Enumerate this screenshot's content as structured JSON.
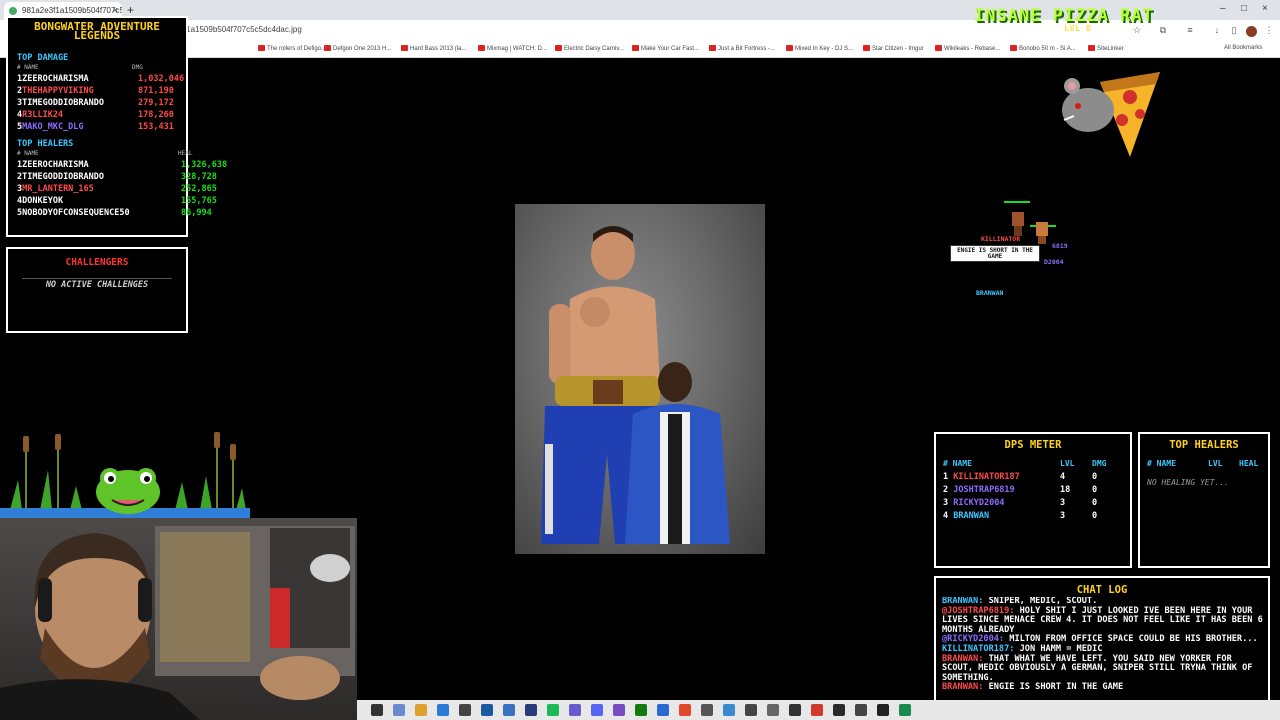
{
  "browser": {
    "tab_title": "981a2e3f1a1509b504f707c5c5dc4dac.jpg",
    "url": "e3f1a1509b504f707c5c5dc4dac.jpg",
    "bookmarks": [
      "The rollers of Defigo...",
      "Defgon One 2013 H...",
      "Hard Bass 2013 (la...",
      "Mixmag | WATCH: D...",
      "Electric Daisy Carniv...",
      "Make Your Car Fast...",
      "Just a Bit Fortress -...",
      "Mixed In Key - DJ S...",
      "Star Citizen - Imgur",
      "Wikileaks - Rebase...",
      "Bonobo 50 m - Si A...",
      "SiteLinker"
    ],
    "all_bookmarks": "All Bookmarks"
  },
  "leaderboard": {
    "title": "BONGWATER ADVENTURE LEGENDS",
    "damage": {
      "heading": "TOP DAMAGE",
      "col_name": "# NAME",
      "col_value": "DMG",
      "rows": [
        {
          "rank": "1",
          "name": "ZEEROCHARISMA",
          "value": "1,032,046"
        },
        {
          "rank": "2",
          "name": "THEHAPPYVIKING",
          "value": "871,190"
        },
        {
          "rank": "3",
          "name": "TIMEGODDIOBRANDO",
          "value": "279,172"
        },
        {
          "rank": "4",
          "name": "R3LLIK24",
          "value": "178,260"
        },
        {
          "rank": "5",
          "name": "MAKO_MKC_DLG",
          "value": "153,431"
        }
      ]
    },
    "heal": {
      "heading": "TOP HEALERS",
      "col_name": "# NAME",
      "col_value": "HEAL",
      "rows": [
        {
          "rank": "1",
          "name": "ZEEROCHARISMA",
          "value": "1,326,638"
        },
        {
          "rank": "2",
          "name": "TIMEGODDIOBRANDO",
          "value": "328,728"
        },
        {
          "rank": "3",
          "name": "MR_LANTERN_165",
          "value": "252,865"
        },
        {
          "rank": "4",
          "name": "DONKEYOK",
          "value": "155,765"
        },
        {
          "rank": "5",
          "name": "NOBODYOFCONSEQUENCE50",
          "value": "86,994"
        }
      ]
    }
  },
  "challengers": {
    "title": "CHALLENGERS",
    "empty": "NO ACTIVE CHALLENGES"
  },
  "scene": {
    "title": "INSANE PIZZA RAT",
    "level": "LVL 8",
    "bubble": "ENGIE IS SHORT IN THE GAME",
    "players": [
      {
        "name": "KILLINATOR",
        "color": "#ff4a4a"
      },
      {
        "name": "6819",
        "color": "#8f6bff"
      },
      {
        "name": "D2004",
        "color": "#8f6bff"
      },
      {
        "name": "BRANWAN",
        "color": "#3bc8ff"
      }
    ]
  },
  "dps": {
    "title": "DPS METER",
    "headers": {
      "name": "# NAME",
      "lvl": "LVL",
      "dmg": "DMG"
    },
    "rows": [
      {
        "rank": "1",
        "name": "KILLINATOR187",
        "lvl": "4",
        "dmg": "0",
        "color": "#ff4a4a"
      },
      {
        "rank": "2",
        "name": "JOSHTRAP6819",
        "lvl": "18",
        "dmg": "0",
        "color": "#8f6bff"
      },
      {
        "rank": "3",
        "name": "RICKYD2004",
        "lvl": "3",
        "dmg": "0",
        "color": "#8f6bff"
      },
      {
        "rank": "4",
        "name": "BRANWAN",
        "lvl": "3",
        "dmg": "0",
        "color": "#3bc8ff"
      }
    ]
  },
  "top_healers": {
    "title": "TOP HEALERS",
    "headers": {
      "name": "# NAME",
      "lvl": "LVL",
      "heal": "HEAL"
    },
    "empty": "NO HEALING YET..."
  },
  "chat": {
    "title": "CHAT LOG",
    "messages": [
      {
        "user": "BRANWAN:",
        "text": "SNIPER, MEDIC, SCOUT.",
        "cls": "u3"
      },
      {
        "user": "@JOSHTRAP6819:",
        "text": "HOLY SHIT I JUST LOOKED IVE BEEN HERE IN YOUR LIVES SINCE MENACE CREW 4. IT DOES NOT FEEL LIKE IT HAS BEEN 6 MONTHS ALREADY",
        "cls": "u"
      },
      {
        "user": "@RICKYD2004:",
        "text": "MILTON FROM OFFICE SPACE COULD BE HIS BROTHER...",
        "cls": "u2"
      },
      {
        "user": "KILLINATOR187:",
        "text": "JON HAMM = MEDIC",
        "cls": "u3"
      },
      {
        "user": "BRANWAN:",
        "text": "THAT WHAT WE HAVE LEFT. YOU SAID NEW YORKER FOR SCOUT, MEDIC OBVIOUSLY A GERMAN, SNIPER STILL TRYNA THINK OF SOMETHING.",
        "cls": "u"
      },
      {
        "user": "BRANWAN:",
        "text": "ENGIE IS SHORT IN THE GAME",
        "cls": "u"
      }
    ]
  },
  "colors": {
    "accent_yellow": "#ffd21a",
    "accent_blue": "#3bc8ff",
    "accent_red": "#ff3333",
    "damage_value": "#ff4a4a",
    "heal_value": "#19e019"
  }
}
